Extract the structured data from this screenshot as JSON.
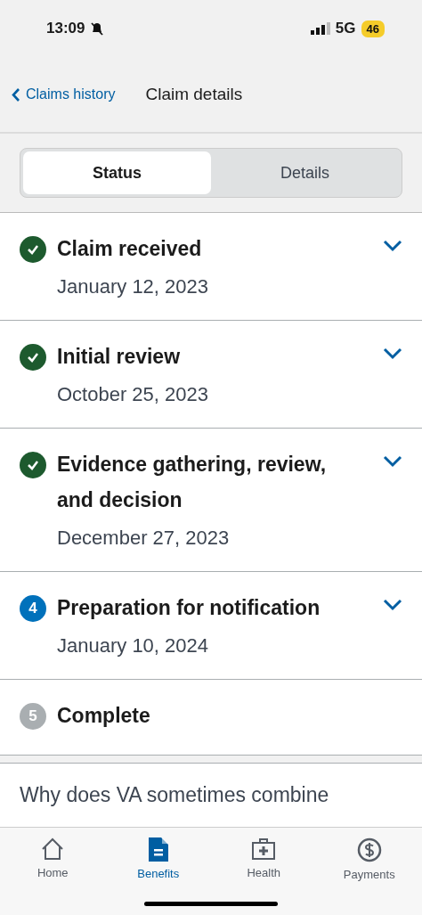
{
  "status_bar": {
    "time": "13:09",
    "network": "5G",
    "battery": "46"
  },
  "nav": {
    "back": "Claims history",
    "title": "Claim details"
  },
  "tabs": [
    {
      "label": "Status",
      "selected": true
    },
    {
      "label": "Details",
      "selected": false
    }
  ],
  "steps": [
    {
      "kind": "complete",
      "title": "Claim received",
      "date": "January 12, 2023",
      "expandable": true
    },
    {
      "kind": "complete",
      "title": "Initial review",
      "date": "October 25, 2023",
      "expandable": true
    },
    {
      "kind": "complete",
      "title": "Evidence gathering, review, and decision",
      "date": "December 27, 2023",
      "expandable": true
    },
    {
      "kind": "current",
      "marker": "4",
      "title": "Preparation for notification",
      "date": "January 10, 2024",
      "expandable": true
    },
    {
      "kind": "pending",
      "marker": "5",
      "title": "Complete",
      "expandable": false
    }
  ],
  "question": "Why does VA sometimes combine",
  "tab_bar": [
    {
      "kind": "home",
      "label": "Home",
      "selected": false
    },
    {
      "kind": "benefits",
      "label": "Benefits",
      "selected": true
    },
    {
      "kind": "health",
      "label": "Health",
      "selected": false
    },
    {
      "kind": "payments",
      "label": "Payments",
      "selected": false
    }
  ]
}
